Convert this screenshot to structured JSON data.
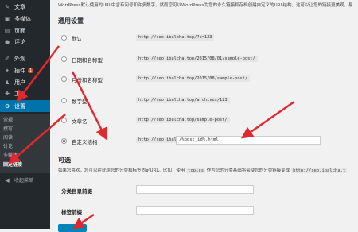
{
  "sidebar": {
    "items": [
      {
        "icon": "pin-icon",
        "label": "文章"
      },
      {
        "icon": "media-icon",
        "label": "多媒体"
      },
      {
        "icon": "page-icon",
        "label": "页面"
      },
      {
        "icon": "comment-icon",
        "label": "评论"
      },
      {
        "icon": "appearance-icon",
        "label": "外观"
      },
      {
        "icon": "plugin-icon",
        "label": "插件",
        "badge": "1"
      },
      {
        "icon": "user-icon",
        "label": "用户"
      },
      {
        "icon": "tools-icon",
        "label": "工具"
      },
      {
        "icon": "settings-icon",
        "label": "设置",
        "active": true
      }
    ],
    "submenu": [
      "常规",
      "撰写",
      "阅读",
      "讨论",
      "多媒体",
      "固定链接"
    ],
    "submenu_current": "固定链接",
    "collapse_label": "收起菜单"
  },
  "main": {
    "intro": "WordPress默认使用的URL中含有问号和许多数字，然而您可以WordPress为您的永久链接和存档创建自定义的URL结构，这可以让您的链接更美观，易",
    "common_heading": "通用设置",
    "options": [
      {
        "label": "默认",
        "example": "http://seo.ibalcha.top/?p=123",
        "checked": false
      },
      {
        "label": "日期和名称型",
        "example": "http://seo.ibalcha.top/2015/08/01/sample-post/",
        "checked": false
      },
      {
        "label": "月份和名称型",
        "example": "http://seo.ibalcha.top/2015/08/sample-post/",
        "checked": false
      },
      {
        "label": "数字型",
        "example": "http://seo.ibalcha.top/archives/123",
        "checked": false
      },
      {
        "label": "文章名",
        "example": "http://seo.ibalcha.top/sample-post/",
        "checked": false
      },
      {
        "label": "自定义结构",
        "example": "http://seo.ibalcha.top",
        "checked": true
      }
    ],
    "custom_value": "/%post_id%.html",
    "optional_heading": "可选",
    "optional_desc_before": "如果您喜欢，您可以在此给您的分类和标签固定URL。比如，使用",
    "optional_desc_code": "topics",
    "optional_desc_after": "作为您的分类基础将会使您的分类链接变成",
    "optional_desc_url": "http://seo.ibalcha.t",
    "category_base_label": "分类目录前缀",
    "tag_base_label": "标签前缀"
  },
  "colors": {
    "sidebar_bg": "#23282d",
    "active": "#0073aa",
    "arrow": "#e0282e"
  }
}
